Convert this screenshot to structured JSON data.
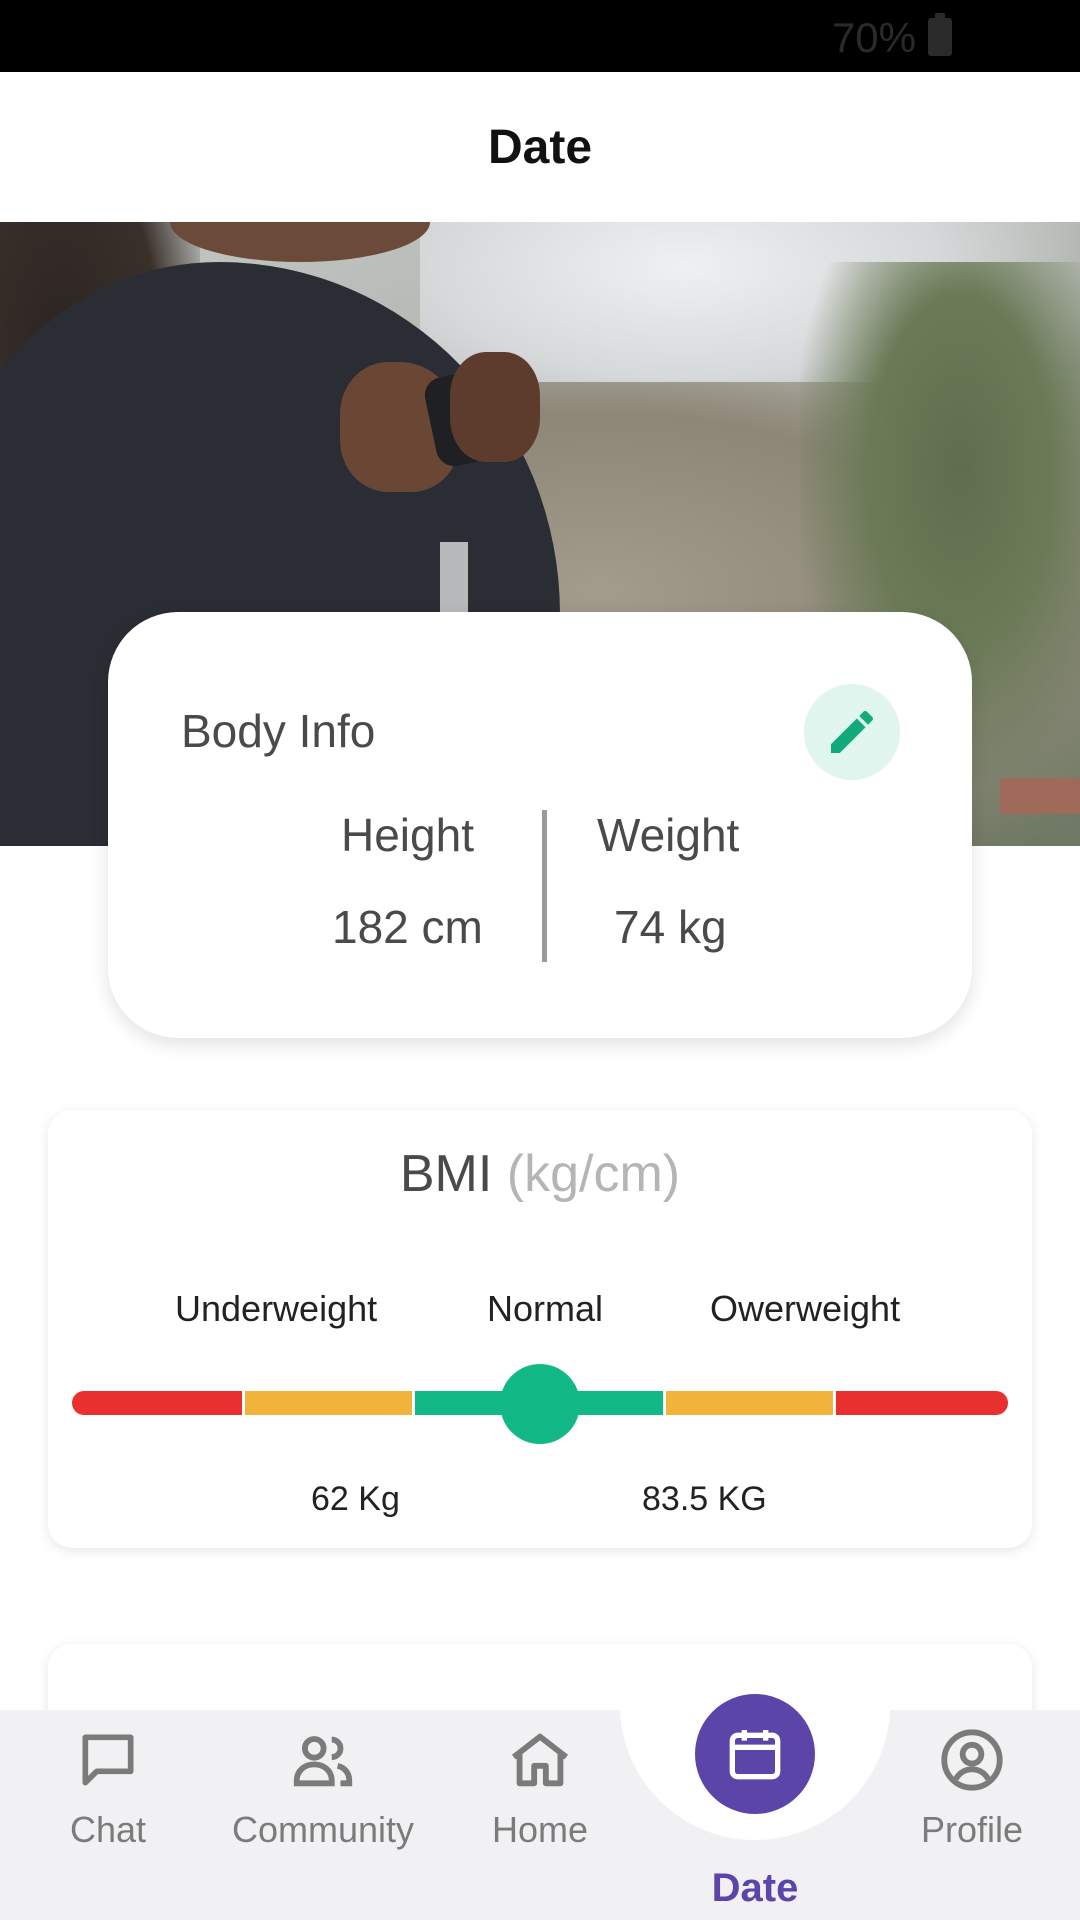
{
  "status_bar": {
    "battery": "70%"
  },
  "header": {
    "title": "Date"
  },
  "body_info": {
    "title": "Body Info",
    "height_label": "Height",
    "height_value": "182 cm",
    "weight_label": "Weight",
    "weight_value": "74 kg"
  },
  "bmi": {
    "title": "BMI",
    "unit": "(kg/cm)",
    "categories": [
      "Underweight",
      "Normal",
      "Owerweight"
    ],
    "lower_limit": "62 Kg",
    "upper_limit": "83.5 KG",
    "indicator_position": 0.5,
    "colors": {
      "red": "#e8312f",
      "amber": "#f0b43a",
      "green": "#12b886"
    }
  },
  "nav": {
    "items": [
      {
        "label": "Chat",
        "icon": "chat-icon"
      },
      {
        "label": "Community",
        "icon": "community-icon"
      },
      {
        "label": "Home",
        "icon": "home-icon"
      },
      {
        "label": "Date",
        "icon": "calendar-icon",
        "active": true
      },
      {
        "label": "Profile",
        "icon": "profile-icon"
      }
    ],
    "active_color": "#5b45a8",
    "inactive_color": "#7b7b7b"
  }
}
